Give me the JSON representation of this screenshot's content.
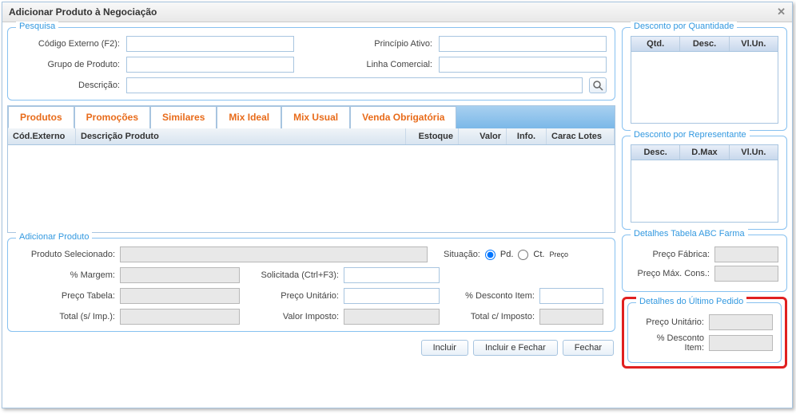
{
  "window": {
    "title": "Adicionar Produto à Negociação"
  },
  "pesquisa": {
    "legend": "Pesquisa",
    "codigo_externo_label": "Código Externo (F2):",
    "grupo_produto_label": "Grupo de Produto:",
    "descricao_label": "Descrição:",
    "principio_ativo_label": "Princípio Ativo:",
    "linha_comercial_label": "Linha Comercial:",
    "codigo_externo": "",
    "grupo_produto": "",
    "descricao": "",
    "principio_ativo": "",
    "linha_comercial": ""
  },
  "tabs": {
    "produtos": "Produtos",
    "promocoes": "Promoções",
    "similares": "Similares",
    "mix_ideal": "Mix Ideal",
    "mix_usual": "Mix Usual",
    "venda_obrig": "Venda Obrigatória"
  },
  "grid": {
    "cod_externo": "Cód.Externo",
    "descricao": "Descrição Produto",
    "estoque": "Estoque",
    "valor": "Valor",
    "info": "Info.",
    "carac": "Carac Lotes"
  },
  "adicionar": {
    "legend": "Adicionar Produto",
    "produto_sel_label": "Produto Selecionado:",
    "situacao_label": "Situação:",
    "pd_label": "Pd.",
    "ct_label": "Ct.",
    "preco_super": "Preço",
    "pct_margem_label": "% Margem:",
    "solicitada_label": "Solicitada (Ctrl+F3):",
    "preco_tabela_label": "Preço Tabela:",
    "preco_unitario_label": "Preço Unitário:",
    "pct_desconto_label": "% Desconto Item:",
    "total_s_imp_label": "Total (s/ Imp.):",
    "valor_imposto_label": "Valor Imposto:",
    "total_c_imp_label": "Total c/ Imposto:",
    "produto_sel": "",
    "pct_margem": "",
    "solicitada": "",
    "preco_tabela": "",
    "preco_unitario": "",
    "pct_desconto": "",
    "total_s_imp": "",
    "valor_imposto": "",
    "total_c_imp": ""
  },
  "buttons": {
    "incluir": "Incluir",
    "incluir_fechar": "Incluir e Fechar",
    "fechar": "Fechar"
  },
  "desc_qtd": {
    "legend": "Desconto por Quantidade",
    "qtd": "Qtd.",
    "desc": "Desc.",
    "vlun": "Vl.Un."
  },
  "desc_rep": {
    "legend": "Desconto por Representante",
    "desc": "Desc.",
    "dmax": "D.Max",
    "vlun": "Vl.Un."
  },
  "abc": {
    "legend": "Detalhes Tabela ABC Farma",
    "preco_fabrica_label": "Preço Fábrica:",
    "preco_max_label": "Preço Máx. Cons.:",
    "preco_fabrica": "",
    "preco_max": ""
  },
  "ultimo": {
    "legend": "Detalhes do Último Pedido",
    "preco_unit_label": "Preço Unitário:",
    "pct_desc_label": "% Desconto Item:",
    "preco_unit": "",
    "pct_desc": ""
  }
}
